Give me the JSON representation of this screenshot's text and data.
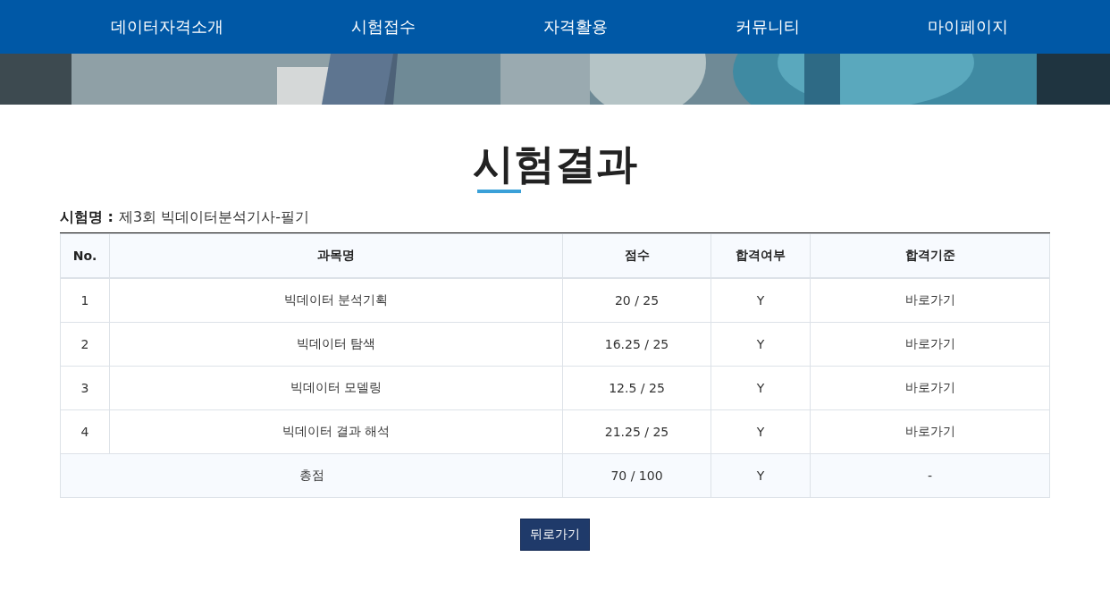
{
  "nav": {
    "items": [
      "데이터자격소개",
      "시험접수",
      "자격활용",
      "커뮤니티",
      "마이페이지"
    ]
  },
  "page_title": "시험결과",
  "exam": {
    "label": "시험명 :",
    "value": "제3회 빅데이터분석기사-필기"
  },
  "table": {
    "columns": [
      "No.",
      "과목명",
      "점수",
      "합격여부",
      "합격기준"
    ],
    "rows": [
      {
        "no": "1",
        "subject": "빅데이터 분석기획",
        "score": "20 / 25",
        "passed": "Y",
        "criterion": "바로가기"
      },
      {
        "no": "2",
        "subject": "빅데이터 탐색",
        "score": "16.25 / 25",
        "passed": "Y",
        "criterion": "바로가기"
      },
      {
        "no": "3",
        "subject": "빅데이터 모델링",
        "score": "12.5 / 25",
        "passed": "Y",
        "criterion": "바로가기"
      },
      {
        "no": "4",
        "subject": "빅데이터 결과 해석",
        "score": "21.25 / 25",
        "passed": "Y",
        "criterion": "바로가기"
      }
    ],
    "total": {
      "label": "총점",
      "score": "70 / 100",
      "passed": "Y",
      "criterion": "-"
    }
  },
  "back_button": "뒤로가기"
}
